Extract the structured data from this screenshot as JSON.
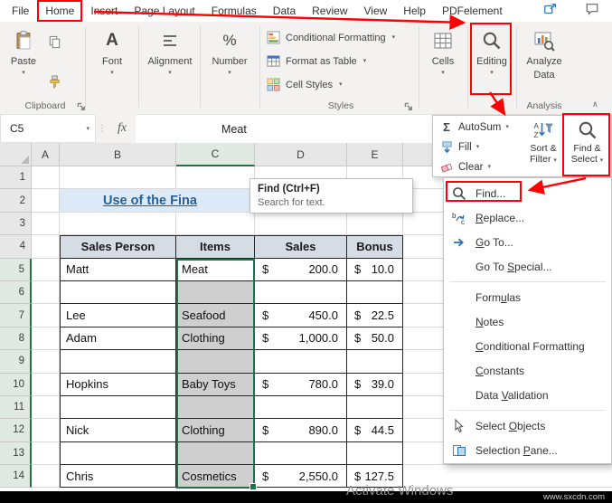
{
  "menubar": {
    "tabs": [
      "File",
      "Home",
      "Insert",
      "Page Layout",
      "Formulas",
      "Data",
      "Review",
      "View",
      "Help",
      "PDFelement"
    ],
    "active_tab": "Home"
  },
  "ribbon": {
    "paste_label": "Paste",
    "font_label": "Font",
    "alignment_label": "Alignment",
    "number_label": "Number",
    "styles_buttons": [
      "Conditional Formatting",
      "Format as Table",
      "Cell Styles"
    ],
    "cells_label": "Cells",
    "editing_label": "Editing",
    "analyze_line1": "Analyze",
    "analyze_line2": "Data",
    "group_clipboard": "Clipboard",
    "group_styles": "Styles",
    "group_analysis": "Analysis"
  },
  "formula_bar": {
    "name_box": "C5",
    "fx": "fx",
    "value": "Meat"
  },
  "editing_menu": {
    "autosum": "AutoSum",
    "fill": "Fill",
    "clear": "Clear",
    "sort_line1": "Sort &",
    "sort_line2": "Filter",
    "find_line1": "Find &",
    "find_line2": "Select"
  },
  "find_menu": {
    "items": [
      {
        "label": "Find...",
        "icon": "magnifier",
        "boxed": true
      },
      {
        "label": "Replace...",
        "icon": "replace",
        "ul": "R"
      },
      {
        "label": "Go To...",
        "icon": "goto",
        "ul": "G"
      },
      {
        "label": "Go To Special...",
        "ul": "S"
      },
      {
        "sep": true
      },
      {
        "label": "Formulas",
        "ul": "u"
      },
      {
        "label": "Notes",
        "ul": "N"
      },
      {
        "label": "Conditional Formatting",
        "ul": "C"
      },
      {
        "label": "Constants",
        "ul": "C"
      },
      {
        "label": "Data Validation",
        "ul": "V"
      },
      {
        "sep": true
      },
      {
        "label": "Select Objects",
        "icon": "pointer",
        "ul": "O"
      },
      {
        "label": "Selection Pane...",
        "icon": "pane",
        "ul": "P"
      }
    ]
  },
  "tooltip": {
    "title": "Find (Ctrl+F)",
    "body": "Search for text."
  },
  "sheet": {
    "columns": [
      "A",
      "B",
      "C",
      "D",
      "E"
    ],
    "row_count": 14,
    "selected_column": "C",
    "selection": {
      "range": "C5:C14",
      "active_cell": "C5"
    },
    "title": "Use of the Fina",
    "table": {
      "headers": [
        "Sales Person",
        "Items",
        "Sales",
        "Bonus"
      ],
      "currency": "$",
      "rows": [
        {
          "person": "Matt",
          "item": "Meat",
          "sales": "200.0",
          "bonus": "10.0"
        },
        {
          "person": "",
          "item": "",
          "sales": "",
          "bonus": ""
        },
        {
          "person": "Lee",
          "item": "Seafood",
          "sales": "450.0",
          "bonus": "22.5"
        },
        {
          "person": "Adam",
          "item": "Clothing",
          "sales": "1,000.0",
          "bonus": "50.0"
        },
        {
          "person": "",
          "item": "",
          "sales": "",
          "bonus": ""
        },
        {
          "person": "Hopkins",
          "item": "Baby Toys",
          "sales": "780.0",
          "bonus": "39.0"
        },
        {
          "person": "",
          "item": "",
          "sales": "",
          "bonus": ""
        },
        {
          "person": "Nick",
          "item": "Clothing",
          "sales": "890.0",
          "bonus": "44.5"
        },
        {
          "person": "",
          "item": "",
          "sales": "",
          "bonus": ""
        },
        {
          "person": "Chris",
          "item": "Cosmetics",
          "sales": "2,550.0",
          "bonus": "127.5"
        }
      ]
    }
  },
  "footer": {
    "activate": "Activate Windows",
    "watermark": "www.sxcdn.com"
  },
  "colors": {
    "accent_green": "#217346",
    "annotation_red": "#FE0000",
    "title_blue": "#2A6099",
    "title_bg": "#DCEAF7",
    "table_header_bg": "#D6DCE4",
    "selection_fill": "#CFCFCF"
  }
}
